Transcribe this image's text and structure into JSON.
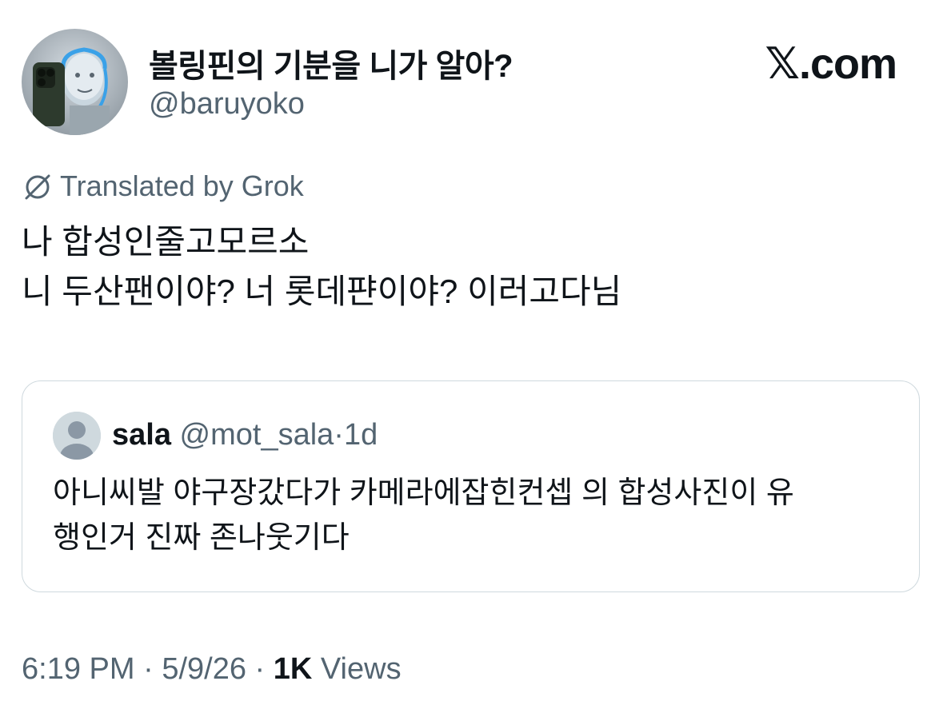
{
  "author": {
    "display_name": "볼링핀의 기분을 니가 알아?",
    "handle": "@baruyoko",
    "avatar_icon": "robot-selfie-avatar"
  },
  "brand": {
    "label": "𝕏.com"
  },
  "translation": {
    "icon": "grok-icon",
    "label": "Translated by Grok"
  },
  "tweet": {
    "lines": [
      "나 합성인줄고모르소",
      "니 두산팬이야? 너 롯데퍈이야? 이러고다님"
    ]
  },
  "quote": {
    "name": "sala",
    "handle": "@mot_sala",
    "separator": "·",
    "age": "1d",
    "avatar_icon": "default-user-avatar",
    "lines": [
      "아니씨발 야구장갔다가 카메라에잡힌컨셉 의 합성사진이 유",
      "행인거 진짜 존나웃기다"
    ]
  },
  "footer": {
    "time": "6:19 PM",
    "sep1": "·",
    "date": "5/9/26",
    "sep2": "·",
    "views_count": "1K",
    "views_label": "Views"
  },
  "colors": {
    "text": "#0f1419",
    "secondary": "#536471",
    "border": "#cfd9de"
  }
}
